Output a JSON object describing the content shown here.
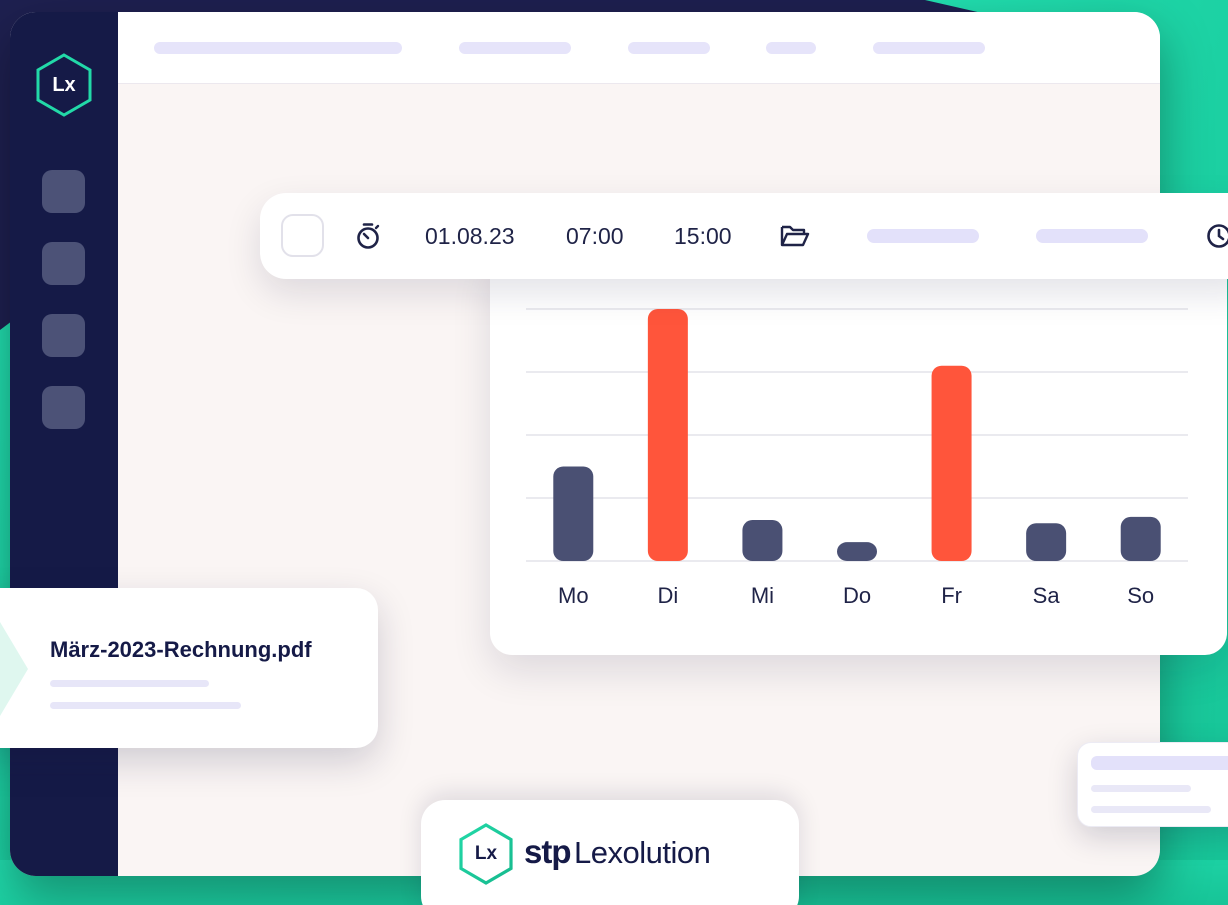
{
  "brand": {
    "logo_mark": "Lx",
    "badge_mark": "Lx",
    "badge_prefix": "stp",
    "badge_name": "Lexolution"
  },
  "time_entry": {
    "date": "01.08.23",
    "start_time": "07:00",
    "end_time": "15:00",
    "icons": [
      "stopwatch-icon",
      "folder-open-icon",
      "clock-icon"
    ]
  },
  "file": {
    "name": "März-2023-Rechnung.pdf"
  },
  "colors": {
    "navy": "#151a47",
    "bar_default": "#4a5073",
    "bar_highlight": "#ff553b",
    "teal": "#1fd6a4"
  },
  "chart_data": {
    "type": "bar",
    "categories": [
      "Mo",
      "Di",
      "Mi",
      "Do",
      "Fr",
      "Sa",
      "So"
    ],
    "values": [
      1.5,
      4.0,
      0.65,
      0.3,
      3.1,
      0.6,
      0.7
    ],
    "highlighted": [
      false,
      true,
      false,
      false,
      true,
      false,
      false
    ],
    "ylim": [
      0,
      4
    ],
    "grid": true,
    "title": "",
    "xlabel": "",
    "ylabel": ""
  }
}
